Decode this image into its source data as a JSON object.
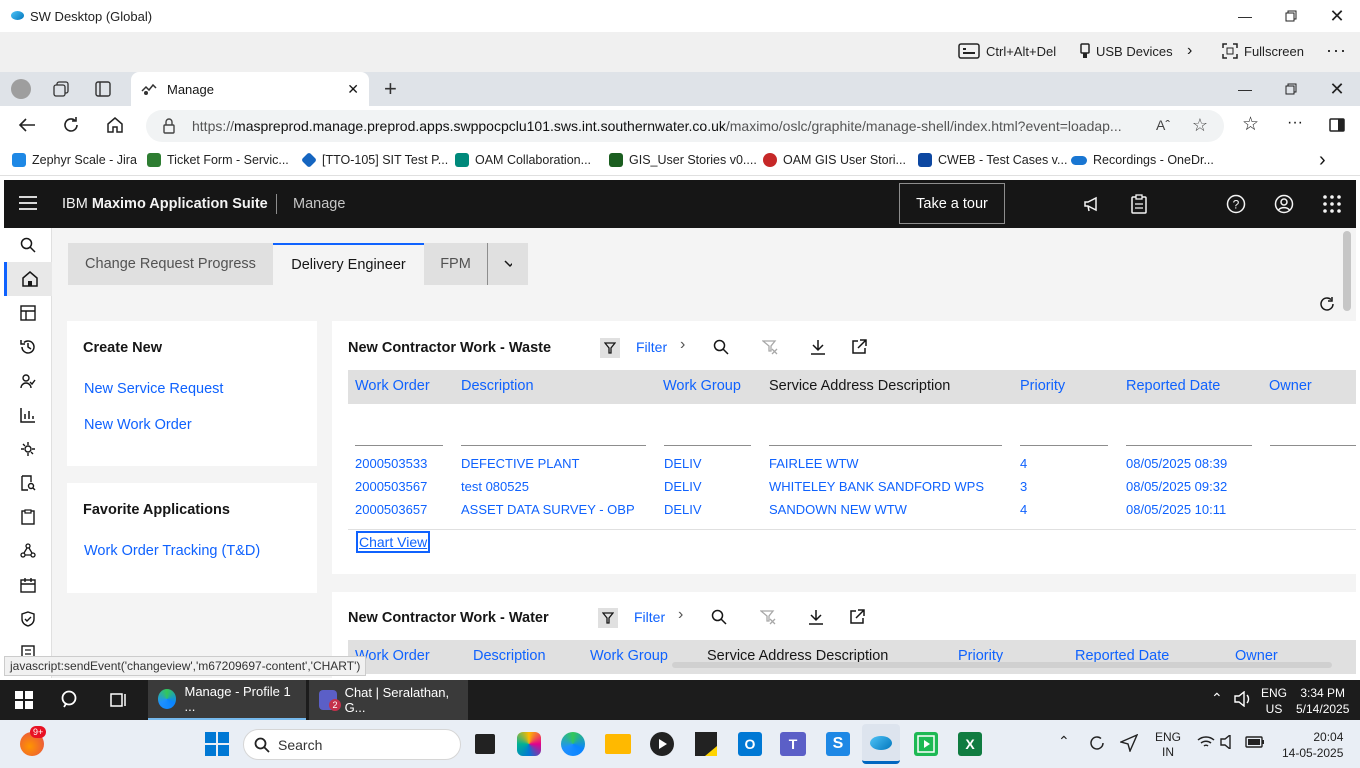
{
  "sw_window": {
    "title": "SW Desktop (Global)",
    "toolbar": {
      "ctrl_alt_del": "Ctrl+Alt+Del",
      "usb": "USB Devices",
      "fullscreen": "Fullscreen"
    }
  },
  "browser": {
    "tab_title": "Manage",
    "url_prefix": "https://",
    "url_host": "maspreprod.manage.preprod.apps.swppocpclu101.sws.int.southernwater.co.uk",
    "url_path": "/maximo/oslc/graphite/manage-shell/index.html?event=loadap...",
    "bookmarks": [
      {
        "label": "Zephyr Scale - Jira",
        "color": "#1e88e5"
      },
      {
        "label": "Ticket Form - Servic...",
        "color": "#2e7d32"
      },
      {
        "label": "[TTO-105] SIT Test P...",
        "color": "#1565c0"
      },
      {
        "label": "OAM Collaboration...",
        "color": "#00897b"
      },
      {
        "label": "GIS_User Stories v0....",
        "color": "#1b5e20"
      },
      {
        "label": "OAM GIS User Stori...",
        "color": "#c62828"
      },
      {
        "label": "CWEB - Test Cases v...",
        "color": "#0d47a1"
      },
      {
        "label": "Recordings - OneDr...",
        "color": "#1976d2"
      }
    ]
  },
  "maximo": {
    "brand_prefix": "IBM",
    "brand_name": "Maximo Application Suite",
    "app_name": "Manage",
    "tour_button": "Take a tour",
    "tabs": [
      {
        "label": "Change Request Progress",
        "active": false
      },
      {
        "label": "Delivery Engineer",
        "active": true
      },
      {
        "label": "FPM",
        "active": false
      }
    ],
    "create_new": {
      "title": "Create New",
      "links": [
        "New Service Request",
        "New Work Order"
      ]
    },
    "favorites": {
      "title": "Favorite Applications",
      "links": [
        "Work Order Tracking (T&D)"
      ]
    },
    "waste": {
      "title": "New Contractor Work - Waste",
      "filter_label": "Filter",
      "columns": [
        "Work Order",
        "Description",
        "Work Group",
        "Service Address Description",
        "Priority",
        "Reported Date",
        "Owner"
      ],
      "rows": [
        [
          "2000503533",
          "DEFECTIVE PLANT",
          "DELIV",
          "FAIRLEE WTW",
          "4",
          "08/05/2025 08:39",
          ""
        ],
        [
          "2000503567",
          "test 080525",
          "DELIV",
          "WHITELEY BANK SANDFORD WPS",
          "3",
          "08/05/2025 09:32",
          ""
        ],
        [
          "2000503657",
          "ASSET DATA SURVEY - OBP",
          "DELIV",
          "SANDOWN NEW WTW",
          "4",
          "08/05/2025 10:11",
          ""
        ]
      ],
      "chart_view": "Chart View"
    },
    "water": {
      "title": "New Contractor Work - Water",
      "filter_label": "Filter",
      "columns": [
        "Work Order",
        "Description",
        "Work Group",
        "Service Address Description",
        "Priority",
        "Reported Date",
        "Owner"
      ]
    }
  },
  "status_bar": "javascript:sendEvent('changeview','m67209697-content','CHART')",
  "remote_taskbar": {
    "apps": [
      {
        "label": "Manage - Profile 1 ..."
      },
      {
        "label": "Chat | Seralathan, G..."
      }
    ],
    "teams_badge": "2",
    "lang_top": "ENG",
    "lang_bottom": "US",
    "time": "3:34 PM",
    "date": "5/14/2025"
  },
  "local_taskbar": {
    "search_placeholder": "Search",
    "firefox_badge": "9+",
    "lang_top": "ENG",
    "lang_bottom": "IN",
    "time": "20:04",
    "date": "14-05-2025"
  }
}
